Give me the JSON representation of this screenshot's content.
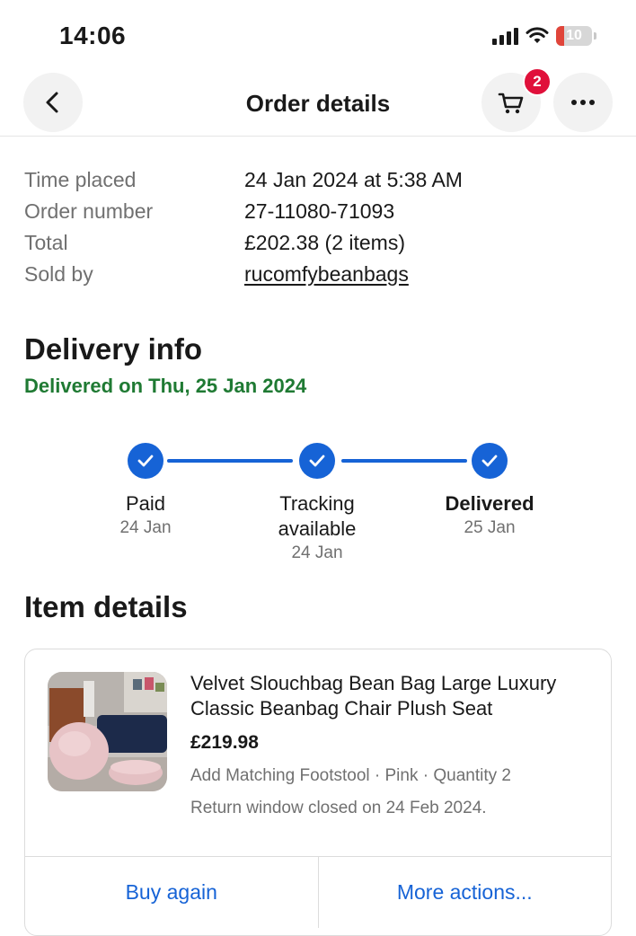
{
  "status_bar": {
    "time": "14:06",
    "battery": "10"
  },
  "header": {
    "title": "Order details",
    "cart_count": "2"
  },
  "summary": [
    {
      "label": "Time placed",
      "value": "24 Jan 2024 at 5:38 AM",
      "link": false
    },
    {
      "label": "Order number",
      "value": "27-11080-71093",
      "link": false
    },
    {
      "label": "Total",
      "value": "£202.38 (2 items)",
      "link": false
    },
    {
      "label": "Sold by",
      "value": "rucomfybeanbags",
      "link": true
    }
  ],
  "delivery": {
    "title": "Delivery info",
    "status": "Delivered on Thu, 25 Jan 2024",
    "steps": [
      {
        "label": "Paid",
        "date": "24 Jan",
        "bold": false
      },
      {
        "label": "Tracking available",
        "date": "24 Jan",
        "bold": false
      },
      {
        "label": "Delivered",
        "date": "25 Jan",
        "bold": true
      }
    ]
  },
  "items": {
    "title": "Item details",
    "item": {
      "title": "Velvet Slouchbag Bean Bag Large Luxury Classic Beanbag Chair Plush Seat",
      "price": "£219.98",
      "meta": "Add Matching Footstool · Pink · Quantity 2",
      "return_note": "Return window closed on 24 Feb 2024.",
      "actions": {
        "buy_again": "Buy again",
        "more_actions": "More actions..."
      }
    }
  },
  "colors": {
    "accent": "#1663d6",
    "success": "#1f7a33",
    "badge": "#e0103a"
  }
}
